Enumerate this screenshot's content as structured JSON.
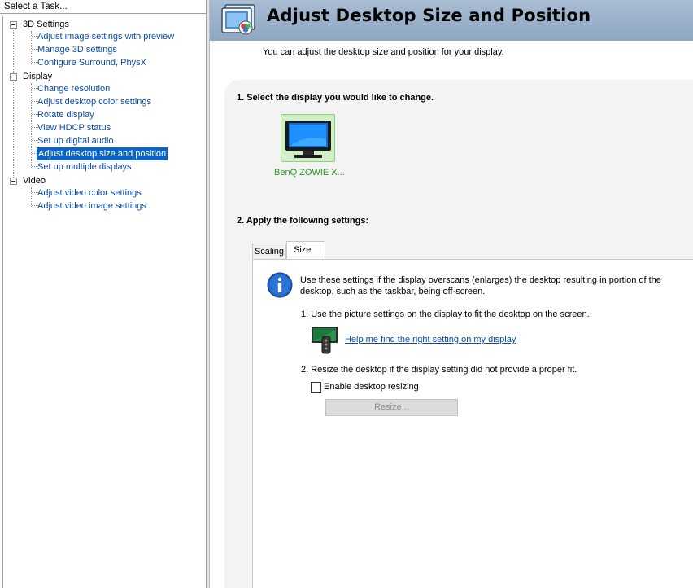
{
  "task_pane": {
    "header": "Select a Task...",
    "categories": [
      {
        "label": "3D Settings",
        "items": [
          "Adjust image settings with preview",
          "Manage 3D settings",
          "Configure Surround, PhysX"
        ]
      },
      {
        "label": "Display",
        "items": [
          "Change resolution",
          "Adjust desktop color settings",
          "Rotate display",
          "View HDCP status",
          "Set up digital audio",
          "Adjust desktop size and position",
          "Set up multiple displays"
        ]
      },
      {
        "label": "Video",
        "items": [
          "Adjust video color settings",
          "Adjust video image settings"
        ]
      }
    ],
    "selected_item": "Adjust desktop size and position"
  },
  "page": {
    "title": "Adjust Desktop Size and Position",
    "description": "You can adjust the desktop size and position for your display."
  },
  "step1": {
    "title": "1. Select the display you would like to change.",
    "display_name": "BenQ ZOWIE X..."
  },
  "step2": {
    "title": "2. Apply the following settings:",
    "tabs": [
      "Scaling",
      "Size"
    ],
    "active_tab": "Size",
    "info_text": "Use these settings if the display overscans (enlarges) the desktop resulting in portion of the desktop, such as the taskbar, being off-screen.",
    "instruction_1": "1. Use the picture settings on the display to fit the desktop on the screen.",
    "help_link": "Help me find the right setting on my display",
    "instruction_2": "2. Resize the desktop if the display setting did not provide a proper fit.",
    "checkbox_label": "Enable desktop resizing",
    "checkbox_checked": false,
    "resize_button": "Resize..."
  },
  "icons": {
    "header": "display-adjust-icon",
    "info": "info-icon",
    "remote": "remote-control-icon",
    "display": "monitor-icon"
  },
  "colors": {
    "header_bg": "#9eb4cc",
    "link": "#0a4aa8",
    "selected_bg": "#0a64c8",
    "display_name": "#2a9a21"
  }
}
